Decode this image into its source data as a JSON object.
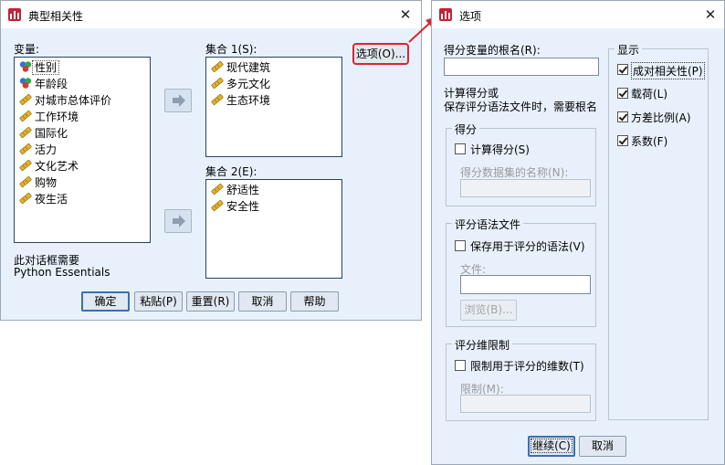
{
  "main_dialog": {
    "title": "典型相关性",
    "variables_label": "变量:",
    "variables": [
      {
        "label": "性别",
        "icon": "nominal-icon"
      },
      {
        "label": "年龄段",
        "icon": "nominal-icon"
      },
      {
        "label": "对城市总体评价",
        "icon": "scale-icon"
      },
      {
        "label": "工作环境",
        "icon": "scale-icon"
      },
      {
        "label": "国际化",
        "icon": "scale-icon"
      },
      {
        "label": "活力",
        "icon": "scale-icon"
      },
      {
        "label": "文化艺术",
        "icon": "scale-icon"
      },
      {
        "label": "购物",
        "icon": "scale-icon"
      },
      {
        "label": "夜生活",
        "icon": "scale-icon"
      }
    ],
    "set1_label": "集合 1(S):",
    "set1_items": [
      "现代建筑",
      "多元文化",
      "生态环境"
    ],
    "set2_label": "集合 2(E):",
    "set2_items": [
      "舒适性",
      "安全性"
    ],
    "options_button": "选项(O)...",
    "note_line1": "此对话框需要",
    "note_line2": "Python Essentials",
    "buttons": {
      "ok": "确定",
      "paste": "粘贴(P)",
      "reset": "重置(R)",
      "cancel": "取消",
      "help": "帮助"
    }
  },
  "options_dialog": {
    "title": "选项",
    "rootname_label": "得分变量的根名(R):",
    "rootname_value": "",
    "info_line1": "计算得分或",
    "info_line2": "保存评分语法文件时，需要根名",
    "scores_group": {
      "title": "得分",
      "compute_label": "计算得分(S)",
      "compute_checked": false,
      "dataset_label": "得分数据集的名称(N):"
    },
    "syntax_group": {
      "title": "评分语法文件",
      "save_label": "保存用于评分的语法(V)",
      "save_checked": false,
      "file_label": "文件:",
      "browse": "浏览(B)..."
    },
    "dims_group": {
      "title": "评分维限制",
      "limit_label": "限制用于评分的维数(T)",
      "limit_checked": false,
      "limit_field_label": "限制(M):"
    },
    "display_group": {
      "title": "显示",
      "items": [
        {
          "label": "成对相关性(P)",
          "checked": true
        },
        {
          "label": "载荷(L)",
          "checked": true
        },
        {
          "label": "方差比例(A)",
          "checked": true
        },
        {
          "label": "系数(F)",
          "checked": true
        }
      ]
    },
    "buttons": {
      "continue": "继续(C)",
      "cancel": "取消"
    }
  },
  "colors": {
    "dialog_bg": "#e8f1fb",
    "highlight": "#d9252f",
    "default_border": "#3a6fb0"
  }
}
